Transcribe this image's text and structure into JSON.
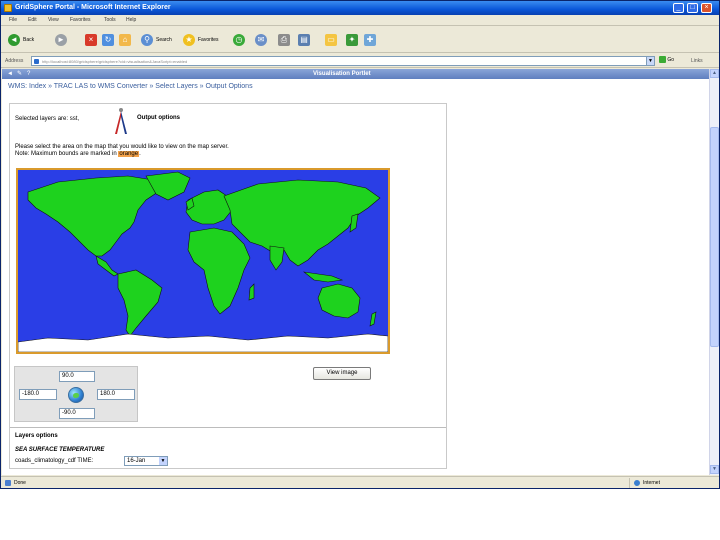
{
  "window": {
    "title": "GridSphere Portal - Microsoft Internet Explorer",
    "minimize_glyph": "_",
    "maximize_glyph": "□",
    "close_glyph": "×"
  },
  "menu": {
    "items": [
      "File",
      "Edit",
      "View",
      "Favorites",
      "Tools",
      "Help"
    ]
  },
  "toolbar": {
    "back_label": "Back",
    "search_label": "Search",
    "favorites_label": "Favorites"
  },
  "address": {
    "label": "Address",
    "url": "http://localhost:8080/gridsphere/gridsphere?cid=visualisation&JavaScript=enabled",
    "go_label": "Go",
    "links_label": "Links"
  },
  "portlet": {
    "title": "Visualisation Portlet",
    "controls": [
      "◄",
      "✎",
      "?"
    ]
  },
  "breadcrumb": "WMS: Index » TRAC LAS to WMS Converter » Select Layers » Output Options",
  "content": {
    "selected_layers_text": "Selected layers are: sst,",
    "output_title": "Output options",
    "instruction_line1": "Please select the area on the map that you would like to view on the map server.",
    "instruction_line2_prefix": "Note: Maximum bounds are marked in",
    "instruction_highlight": "orange",
    "instruction_line2_suffix": "."
  },
  "bounds": {
    "north": "90.0",
    "west": "-180.0",
    "east": "180.0",
    "south": "-90.0"
  },
  "view_button_label": "View image",
  "layers": {
    "heading": "Layers options",
    "layer_name": "SEA SURFACE TEMPERATURE",
    "layer_details": "coads_climatology_cdf  TIME:",
    "time_value": "16-Jan"
  },
  "status": {
    "text": "Done",
    "zone": "Internet"
  },
  "colors": {
    "ocean": "#2a3ee6",
    "land": "#1ed21e",
    "ice": "#ffffff",
    "bounds_border": "#d99a2c"
  }
}
